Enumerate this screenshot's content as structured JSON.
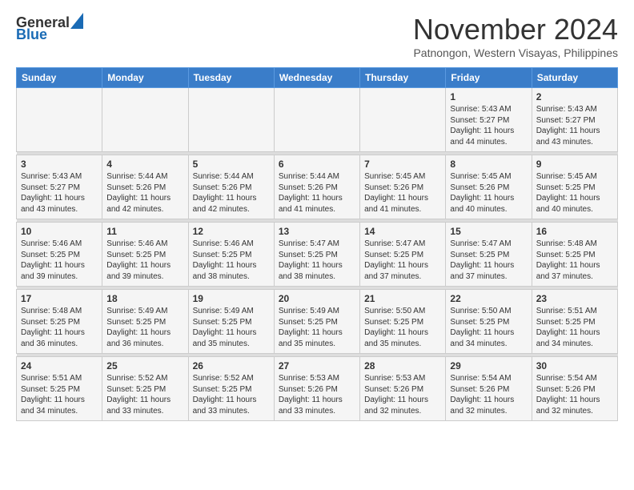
{
  "header": {
    "logo_general": "General",
    "logo_blue": "Blue",
    "month_title": "November 2024",
    "location": "Patnongon, Western Visayas, Philippines"
  },
  "weekdays": [
    "Sunday",
    "Monday",
    "Tuesday",
    "Wednesday",
    "Thursday",
    "Friday",
    "Saturday"
  ],
  "weeks": [
    [
      {
        "day": "",
        "info": ""
      },
      {
        "day": "",
        "info": ""
      },
      {
        "day": "",
        "info": ""
      },
      {
        "day": "",
        "info": ""
      },
      {
        "day": "",
        "info": ""
      },
      {
        "day": "1",
        "info": "Sunrise: 5:43 AM\nSunset: 5:27 PM\nDaylight: 11 hours\nand 44 minutes."
      },
      {
        "day": "2",
        "info": "Sunrise: 5:43 AM\nSunset: 5:27 PM\nDaylight: 11 hours\nand 43 minutes."
      }
    ],
    [
      {
        "day": "3",
        "info": "Sunrise: 5:43 AM\nSunset: 5:27 PM\nDaylight: 11 hours\nand 43 minutes."
      },
      {
        "day": "4",
        "info": "Sunrise: 5:44 AM\nSunset: 5:26 PM\nDaylight: 11 hours\nand 42 minutes."
      },
      {
        "day": "5",
        "info": "Sunrise: 5:44 AM\nSunset: 5:26 PM\nDaylight: 11 hours\nand 42 minutes."
      },
      {
        "day": "6",
        "info": "Sunrise: 5:44 AM\nSunset: 5:26 PM\nDaylight: 11 hours\nand 41 minutes."
      },
      {
        "day": "7",
        "info": "Sunrise: 5:45 AM\nSunset: 5:26 PM\nDaylight: 11 hours\nand 41 minutes."
      },
      {
        "day": "8",
        "info": "Sunrise: 5:45 AM\nSunset: 5:26 PM\nDaylight: 11 hours\nand 40 minutes."
      },
      {
        "day": "9",
        "info": "Sunrise: 5:45 AM\nSunset: 5:25 PM\nDaylight: 11 hours\nand 40 minutes."
      }
    ],
    [
      {
        "day": "10",
        "info": "Sunrise: 5:46 AM\nSunset: 5:25 PM\nDaylight: 11 hours\nand 39 minutes."
      },
      {
        "day": "11",
        "info": "Sunrise: 5:46 AM\nSunset: 5:25 PM\nDaylight: 11 hours\nand 39 minutes."
      },
      {
        "day": "12",
        "info": "Sunrise: 5:46 AM\nSunset: 5:25 PM\nDaylight: 11 hours\nand 38 minutes."
      },
      {
        "day": "13",
        "info": "Sunrise: 5:47 AM\nSunset: 5:25 PM\nDaylight: 11 hours\nand 38 minutes."
      },
      {
        "day": "14",
        "info": "Sunrise: 5:47 AM\nSunset: 5:25 PM\nDaylight: 11 hours\nand 37 minutes."
      },
      {
        "day": "15",
        "info": "Sunrise: 5:47 AM\nSunset: 5:25 PM\nDaylight: 11 hours\nand 37 minutes."
      },
      {
        "day": "16",
        "info": "Sunrise: 5:48 AM\nSunset: 5:25 PM\nDaylight: 11 hours\nand 37 minutes."
      }
    ],
    [
      {
        "day": "17",
        "info": "Sunrise: 5:48 AM\nSunset: 5:25 PM\nDaylight: 11 hours\nand 36 minutes."
      },
      {
        "day": "18",
        "info": "Sunrise: 5:49 AM\nSunset: 5:25 PM\nDaylight: 11 hours\nand 36 minutes."
      },
      {
        "day": "19",
        "info": "Sunrise: 5:49 AM\nSunset: 5:25 PM\nDaylight: 11 hours\nand 35 minutes."
      },
      {
        "day": "20",
        "info": "Sunrise: 5:49 AM\nSunset: 5:25 PM\nDaylight: 11 hours\nand 35 minutes."
      },
      {
        "day": "21",
        "info": "Sunrise: 5:50 AM\nSunset: 5:25 PM\nDaylight: 11 hours\nand 35 minutes."
      },
      {
        "day": "22",
        "info": "Sunrise: 5:50 AM\nSunset: 5:25 PM\nDaylight: 11 hours\nand 34 minutes."
      },
      {
        "day": "23",
        "info": "Sunrise: 5:51 AM\nSunset: 5:25 PM\nDaylight: 11 hours\nand 34 minutes."
      }
    ],
    [
      {
        "day": "24",
        "info": "Sunrise: 5:51 AM\nSunset: 5:25 PM\nDaylight: 11 hours\nand 34 minutes."
      },
      {
        "day": "25",
        "info": "Sunrise: 5:52 AM\nSunset: 5:25 PM\nDaylight: 11 hours\nand 33 minutes."
      },
      {
        "day": "26",
        "info": "Sunrise: 5:52 AM\nSunset: 5:25 PM\nDaylight: 11 hours\nand 33 minutes."
      },
      {
        "day": "27",
        "info": "Sunrise: 5:53 AM\nSunset: 5:26 PM\nDaylight: 11 hours\nand 33 minutes."
      },
      {
        "day": "28",
        "info": "Sunrise: 5:53 AM\nSunset: 5:26 PM\nDaylight: 11 hours\nand 32 minutes."
      },
      {
        "day": "29",
        "info": "Sunrise: 5:54 AM\nSunset: 5:26 PM\nDaylight: 11 hours\nand 32 minutes."
      },
      {
        "day": "30",
        "info": "Sunrise: 5:54 AM\nSunset: 5:26 PM\nDaylight: 11 hours\nand 32 minutes."
      }
    ]
  ]
}
